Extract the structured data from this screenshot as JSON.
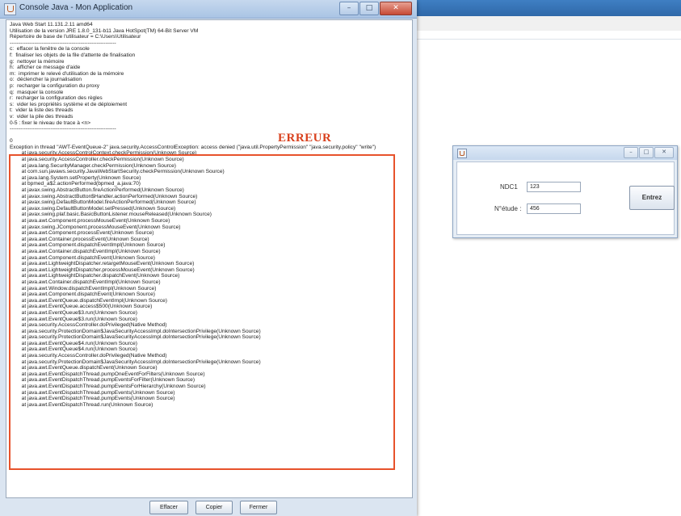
{
  "console": {
    "title": "Console Java - Mon Application",
    "window_controls": [
      "–",
      "□",
      "✕"
    ],
    "log_header": "Java Web Start 11.131.2.11 amd64\nUtilisation de la version JRE 1.8.0_131-b11 Java HotSpot(TM) 64-Bit Server VM\nRépertoire de base de l'utilisateur = C:\\Users\\Utilisateur\n------------------------------------------------------------\nc:  effacer la fenêtre de la console\nf:  finaliser les objets de la file d'attente de finalisation\ng:  nettoyer la mémoire\nh:  afficher ce message d'aide\nm:  imprimer le relevé d'utilisation de la mémoire\no:  déclencher la journalisation\np:  recharger la configuration du proxy\nq:  masquer la console\nr:  recharger la configuration des règles\ns:  vider les propriétés système et de déploiement\nt:  vider la liste des threads\nv:  vider la pile des threads\n0-5 : fixer le niveau de trace à <n>\n------------------------------------------------------------\n\n0",
    "error_label": "ERREUR",
    "stack_trace": "Exception in thread \"AWT-EventQueue-2\" java.security.AccessControlException: access denied (\"java.util.PropertyPermission\" \"java.security.policy\" \"write\")\n\tat java.security.AccessControlContext.checkPermission(Unknown Source)\n\tat java.security.AccessController.checkPermission(Unknown Source)\n\tat java.lang.SecurityManager.checkPermission(Unknown Source)\n\tat com.sun.javaws.security.JavaWebStartSecurity.checkPermission(Unknown Source)\n\tat java.lang.System.setProperty(Unknown Source)\n\tat bpmed_a$2.actionPerformed(bpmed_a.java:70)\n\tat javax.swing.AbstractButton.fireActionPerformed(Unknown Source)\n\tat javax.swing.AbstractButton$Handler.actionPerformed(Unknown Source)\n\tat javax.swing.DefaultButtonModel.fireActionPerformed(Unknown Source)\n\tat javax.swing.DefaultButtonModel.setPressed(Unknown Source)\n\tat javax.swing.plaf.basic.BasicButtonListener.mouseReleased(Unknown Source)\n\tat java.awt.Component.processMouseEvent(Unknown Source)\n\tat javax.swing.JComponent.processMouseEvent(Unknown Source)\n\tat java.awt.Component.processEvent(Unknown Source)\n\tat java.awt.Container.processEvent(Unknown Source)\n\tat java.awt.Component.dispatchEventImpl(Unknown Source)\n\tat java.awt.Container.dispatchEventImpl(Unknown Source)\n\tat java.awt.Component.dispatchEvent(Unknown Source)\n\tat java.awt.LightweightDispatcher.retargetMouseEvent(Unknown Source)\n\tat java.awt.LightweightDispatcher.processMouseEvent(Unknown Source)\n\tat java.awt.LightweightDispatcher.dispatchEvent(Unknown Source)\n\tat java.awt.Container.dispatchEventImpl(Unknown Source)\n\tat java.awt.Window.dispatchEventImpl(Unknown Source)\n\tat java.awt.Component.dispatchEvent(Unknown Source)\n\tat java.awt.EventQueue.dispatchEventImpl(Unknown Source)\n\tat java.awt.EventQueue.access$500(Unknown Source)\n\tat java.awt.EventQueue$3.run(Unknown Source)\n\tat java.awt.EventQueue$3.run(Unknown Source)\n\tat java.security.AccessController.doPrivileged(Native Method)\n\tat java.security.ProtectionDomain$JavaSecurityAccessImpl.doIntersectionPrivilege(Unknown Source)\n\tat java.security.ProtectionDomain$JavaSecurityAccessImpl.doIntersectionPrivilege(Unknown Source)\n\tat java.awt.EventQueue$4.run(Unknown Source)\n\tat java.awt.EventQueue$4.run(Unknown Source)\n\tat java.security.AccessController.doPrivileged(Native Method)\n\tat java.security.ProtectionDomain$JavaSecurityAccessImpl.doIntersectionPrivilege(Unknown Source)\n\tat java.awt.EventQueue.dispatchEvent(Unknown Source)\n\tat java.awt.EventDispatchThread.pumpOneEventForFilters(Unknown Source)\n\tat java.awt.EventDispatchThread.pumpEventsForFilter(Unknown Source)\n\tat java.awt.EventDispatchThread.pumpEventsForHierarchy(Unknown Source)\n\tat java.awt.EventDispatchThread.pumpEvents(Unknown Source)\n\tat java.awt.EventDispatchThread.pumpEvents(Unknown Source)\n\tat java.awt.EventDispatchThread.run(Unknown Source)",
    "buttons": {
      "clear": "Effacer",
      "copy": "Copier",
      "close": "Fermer"
    }
  },
  "form": {
    "window_controls": [
      "–",
      "□",
      "✕"
    ],
    "ndc1_label": "NDC1",
    "ndc1_value": "123",
    "netude_label": "N°étude :",
    "netude_value": "456",
    "submit_label": "Entrez"
  },
  "colors": {
    "error_highlight": "#e7522b",
    "titlebar": "#a9c4e4"
  }
}
